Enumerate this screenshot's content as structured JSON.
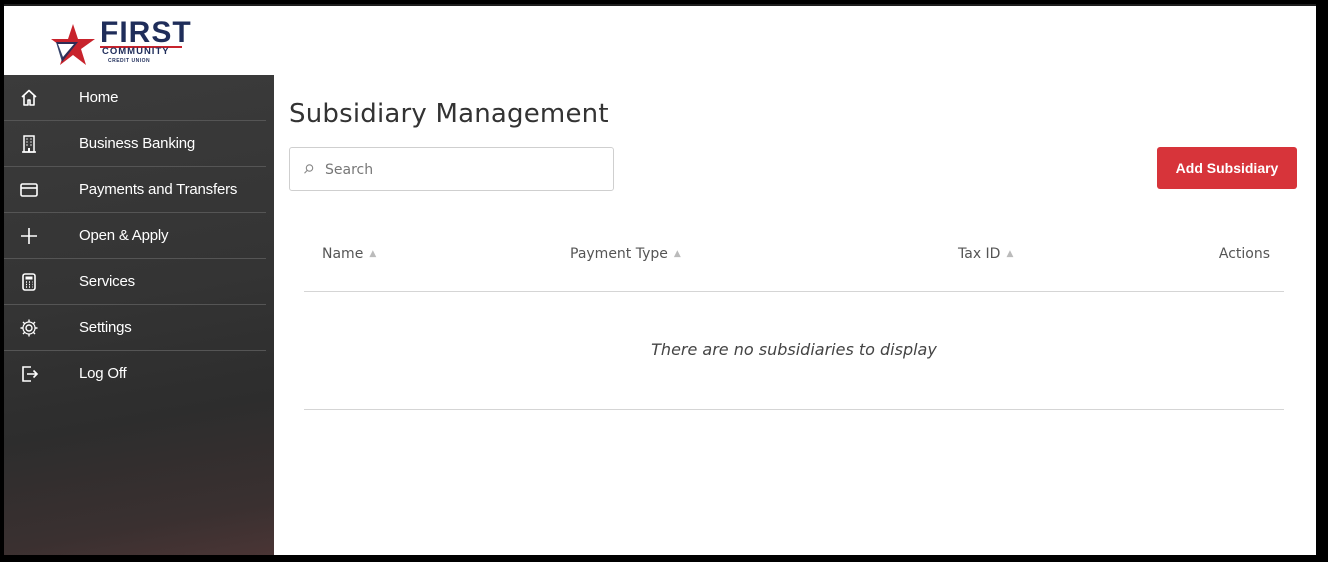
{
  "brand": {
    "name": "FIRST",
    "line2": "COMMUNITY",
    "line3": "CREDIT UNION"
  },
  "sidebar": {
    "items": [
      {
        "label": "Home",
        "icon": "home-icon"
      },
      {
        "label": "Business Banking",
        "icon": "building-icon"
      },
      {
        "label": "Payments and Transfers",
        "icon": "credit-card-icon"
      },
      {
        "label": "Open & Apply",
        "icon": "plus-icon"
      },
      {
        "label": "Services",
        "icon": "calculator-icon"
      },
      {
        "label": "Settings",
        "icon": "gear-icon"
      },
      {
        "label": "Log Off",
        "icon": "log-off-icon"
      }
    ]
  },
  "main": {
    "title": "Subsidiary Management",
    "search_placeholder": "Search",
    "add_button": "Add Subsidiary",
    "columns": [
      {
        "label": "Name"
      },
      {
        "label": "Payment Type"
      },
      {
        "label": "Tax ID"
      },
      {
        "label": "Actions"
      }
    ],
    "empty_message": "There are no subsidiaries to display"
  },
  "colors": {
    "accent": "#d7343a",
    "sidebar_bg": "#343434",
    "brand_navy": "#1f2d5a"
  }
}
